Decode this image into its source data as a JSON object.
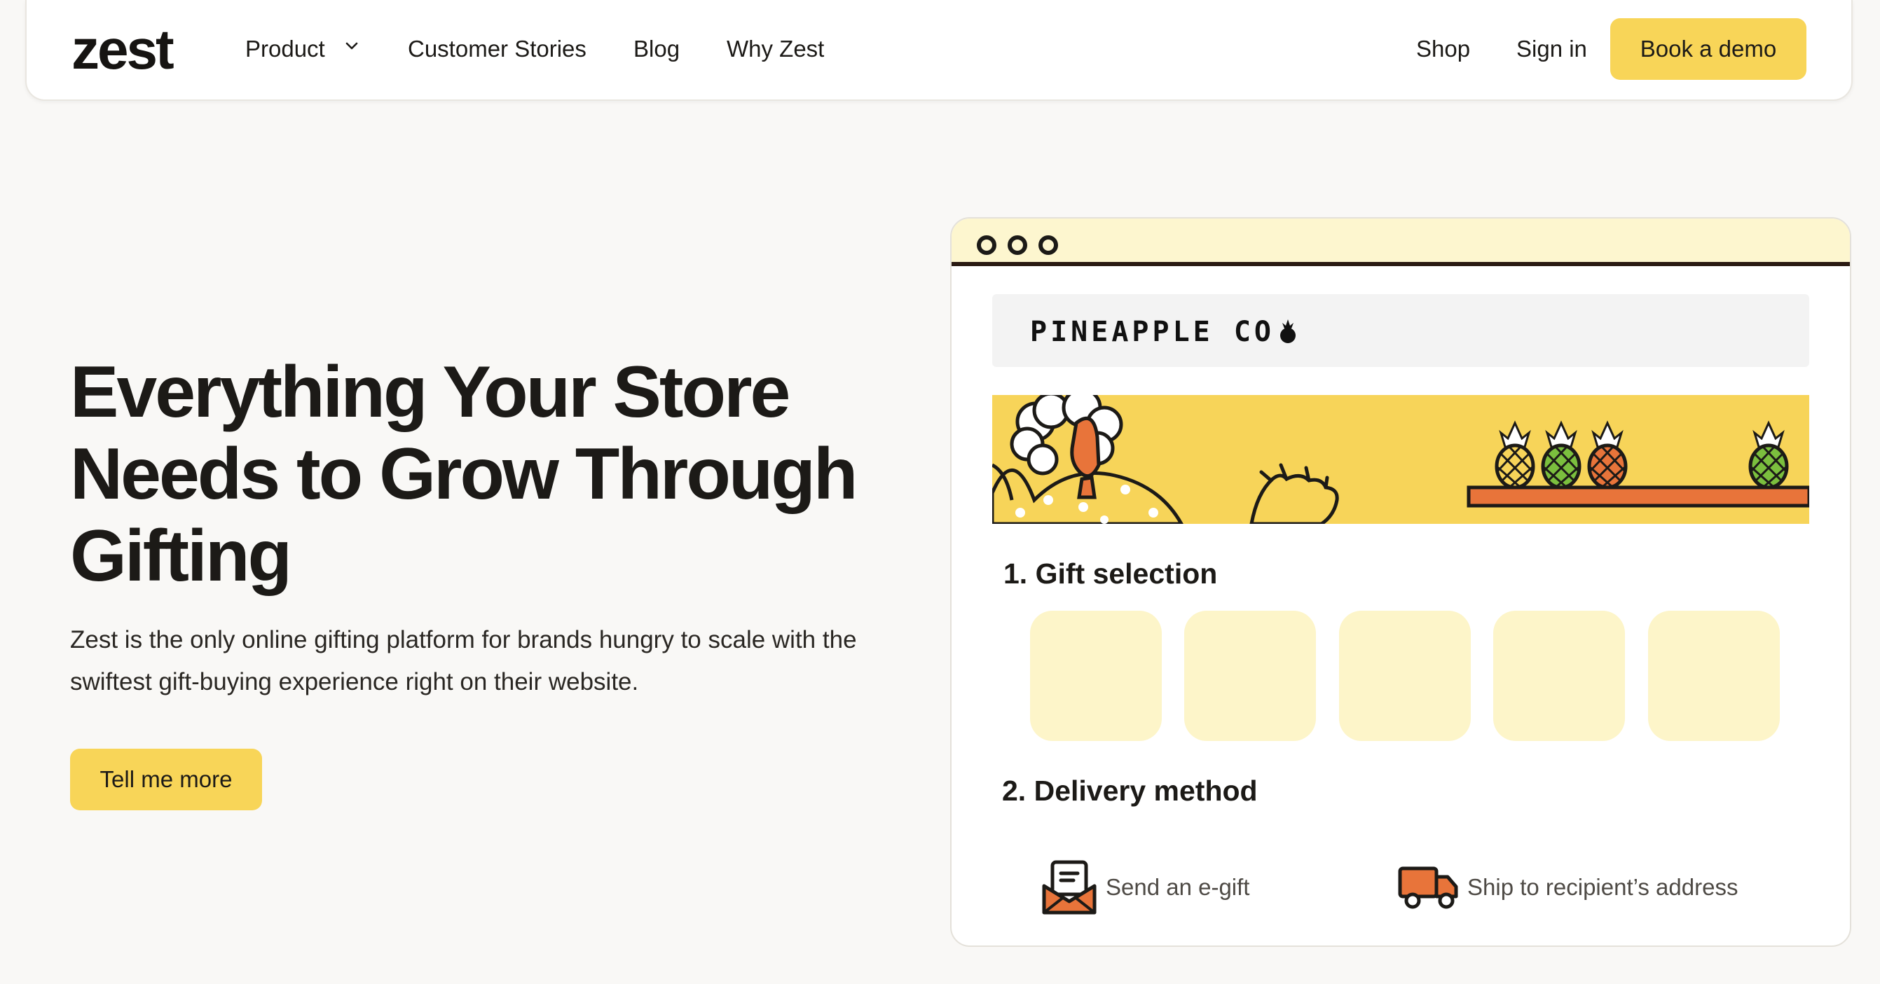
{
  "nav": {
    "logo": "zest",
    "links": [
      "Product",
      "Customer Stories",
      "Blog",
      "Why Zest"
    ],
    "shop": "Shop",
    "signin": "Sign in",
    "demo": "Book a demo"
  },
  "hero": {
    "title": "Everything Your Store Needs to Grow Through Gifting",
    "subtitle": "Zest is the only online gifting platform for brands hungry to scale with the swiftest gift-buying experience right on their website.",
    "cta": "Tell me more"
  },
  "mock": {
    "store_name": "PINEAPPLE CO",
    "section1": "1. Gift selection",
    "section2": "2. Delivery method",
    "options": [
      "Send an e-gift",
      "Ship to recipient’s address"
    ]
  },
  "colors": {
    "accent": "#f8d558",
    "tile": "#fdf5c9",
    "orange": "#e8743a",
    "green": "#7bbf3e"
  },
  "icons": [
    "chevron-down-icon",
    "pineapple-icon",
    "envelope-icon",
    "truck-icon"
  ]
}
